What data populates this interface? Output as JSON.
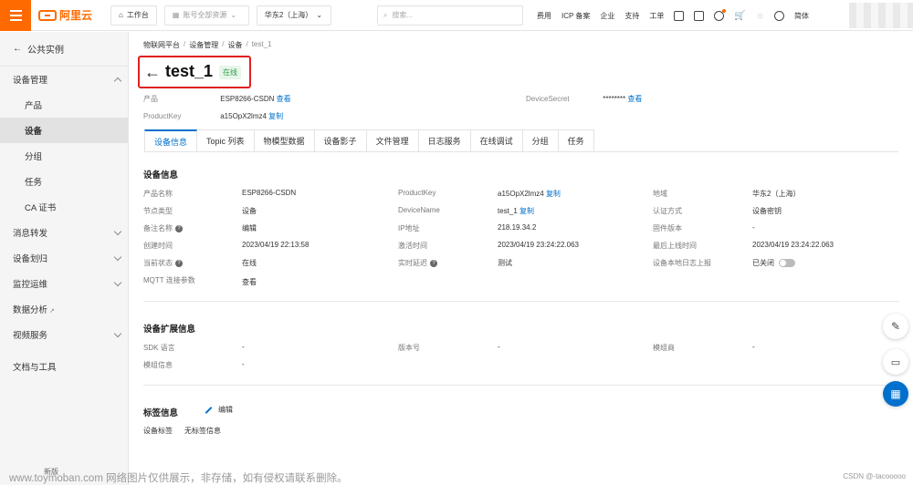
{
  "topbar": {
    "brand": "阿里云",
    "workbench": "工作台",
    "account_scope": "账号全部资源",
    "region": "华东2（上海）",
    "search_placeholder": "搜索...",
    "links": [
      "费用",
      "ICP 备案",
      "企业",
      "支持",
      "工单"
    ],
    "lang": "简体"
  },
  "sidebar": {
    "back_label": "公共实例",
    "device_mgmt": "设备管理",
    "sub_items": [
      "产品",
      "设备",
      "分组",
      "任务",
      "CA 证书"
    ],
    "items": [
      "消息转发",
      "设备划归",
      "监控运维",
      "数据分析",
      "视频服务"
    ],
    "docs": "文档与工具",
    "footer": "新版"
  },
  "breadcrumb": [
    "物联网平台",
    "设备管理",
    "设备",
    "test_1"
  ],
  "device": {
    "name": "test_1",
    "status_badge": "在线",
    "product_label": "产品",
    "product_value": "ESP8266-CSDN",
    "product_link": "查看",
    "secret_label": "DeviceSecret",
    "secret_value": "********",
    "secret_link": "查看",
    "productkey_label": "ProductKey",
    "productkey_value": "a15OpX2lmz4",
    "copy_link": "复制"
  },
  "tabs": [
    "设备信息",
    "Topic 列表",
    "物模型数据",
    "设备影子",
    "文件管理",
    "日志服务",
    "在线调试",
    "分组",
    "任务"
  ],
  "info": {
    "title": "设备信息",
    "rows": [
      [
        {
          "k": "产品名称",
          "v": "ESP8266-CSDN"
        },
        {
          "k": "ProductKey",
          "v": "a15OpX2lmz4",
          "link": "复制"
        },
        {
          "k": "地域",
          "v": "华东2（上海）"
        }
      ],
      [
        {
          "k": "节点类型",
          "v": "设备"
        },
        {
          "k": "DeviceName",
          "v": "test_1",
          "link": "复制"
        },
        {
          "k": "认证方式",
          "v": "设备密钥"
        }
      ],
      [
        {
          "k": "备注名称",
          "v": "编辑"
        },
        {
          "k": "IP地址",
          "v": "218.19.34.2"
        },
        {
          "k": "固件版本",
          "v": "-"
        }
      ],
      [
        {
          "k": "创建时间",
          "v": "2023/04/19 22:13:58"
        },
        {
          "k": "激活时间",
          "v": "2023/04/19 23:24:22.063"
        },
        {
          "k": "最后上线时间",
          "v": "2023/04/19 23:24:22.063"
        }
      ],
      [
        {
          "k": "当前状态",
          "v": "在线"
        },
        {
          "k": "实时延迟",
          "v": "测试"
        },
        {
          "k": "设备本地日志上报",
          "v": "已关闭"
        }
      ],
      [
        {
          "k": "MQTT 连接参数",
          "v": "查看"
        }
      ]
    ]
  },
  "ext": {
    "title": "设备扩展信息",
    "rows": [
      [
        {
          "k": "SDK 语言",
          "v": "-"
        },
        {
          "k": "版本号",
          "v": "-"
        },
        {
          "k": "模组商",
          "v": "-"
        }
      ],
      [
        {
          "k": "模组信息",
          "v": "-"
        }
      ]
    ]
  },
  "tags": {
    "title": "标签信息",
    "edit": "编辑",
    "label": "设备标签",
    "value": "无标签信息"
  },
  "watermark": "www.toymoban.com 网络图片仅供展示，非存储，如有侵权请联系删除。",
  "watermark_right": "CSDN @-tacooooo",
  "colors": {
    "brand": "#ff6a00",
    "link": "#0070cc",
    "highlight": "#e02020",
    "online": "#2f9d47"
  }
}
